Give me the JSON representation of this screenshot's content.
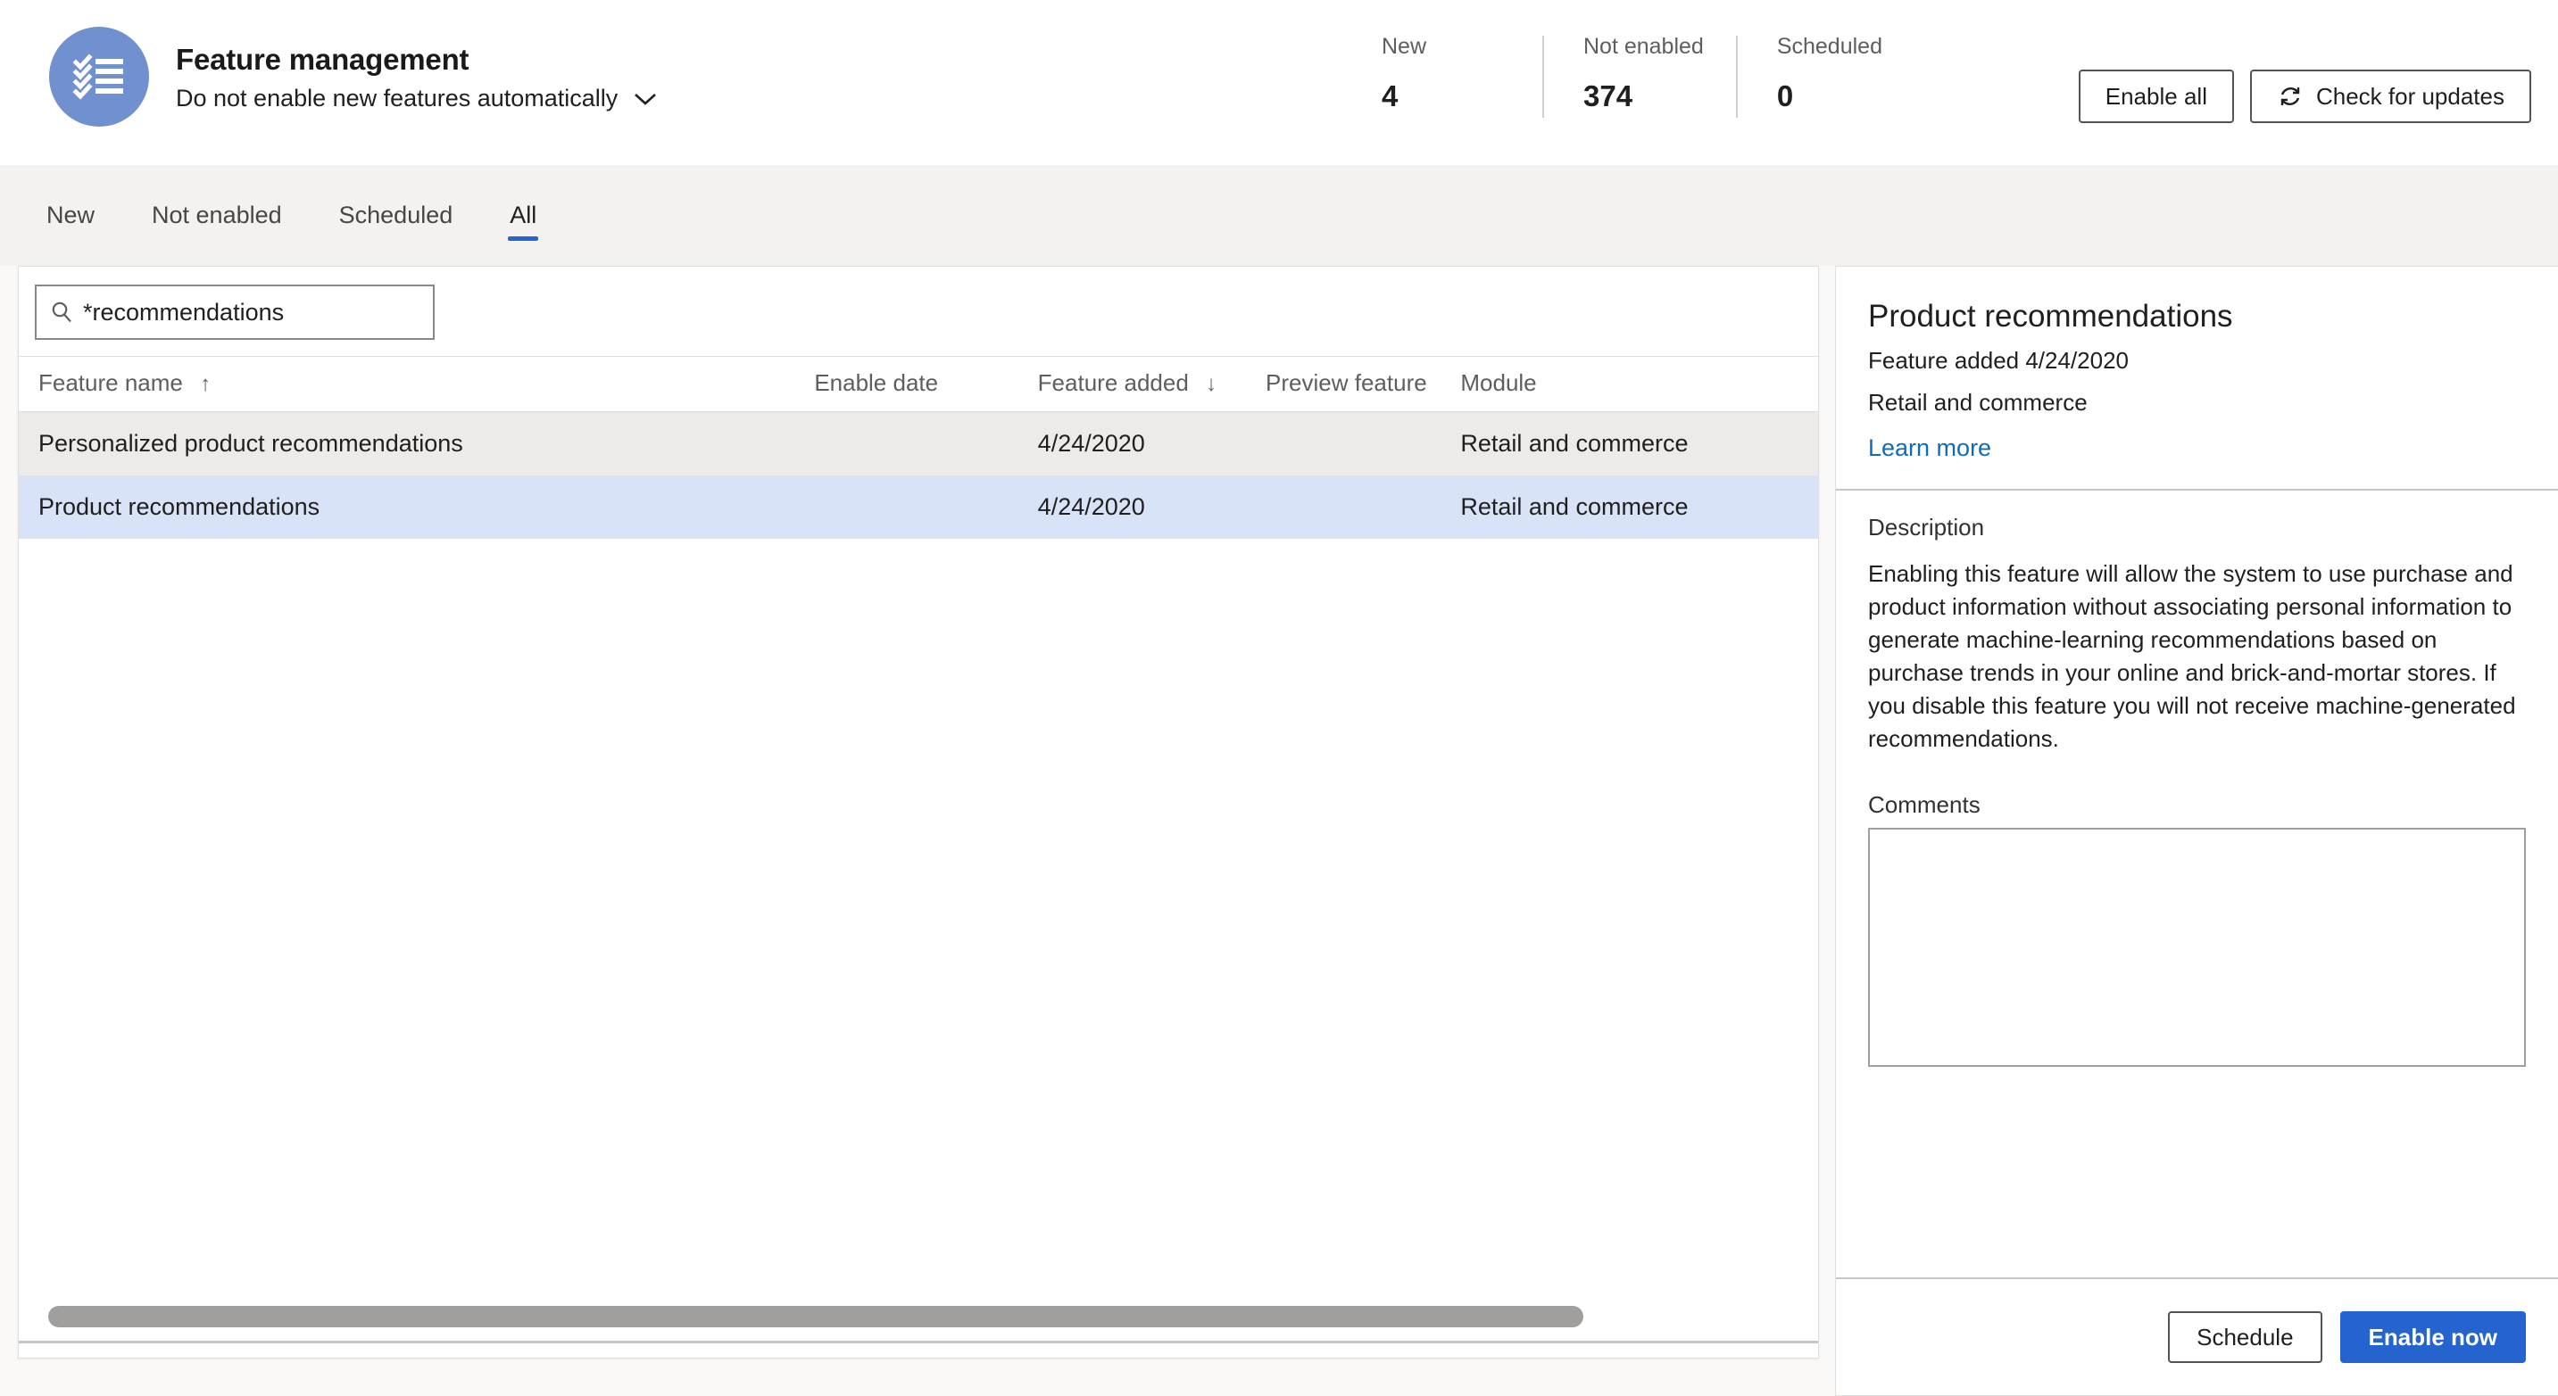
{
  "header": {
    "app_icon_name": "checklist-icon",
    "title": "Feature management",
    "subtitle": "Do not enable new features automatically",
    "subtitle_chevron": "chevron-down-icon",
    "stats": [
      {
        "label": "New",
        "value": "4"
      },
      {
        "label": "Not enabled",
        "value": "374"
      },
      {
        "label": "Scheduled",
        "value": "0"
      }
    ],
    "actions": {
      "enable_all": "Enable all",
      "check_updates": "Check for updates",
      "check_updates_icon": "refresh-icon"
    }
  },
  "tabs": [
    {
      "label": "New",
      "active": false
    },
    {
      "label": "Not enabled",
      "active": false
    },
    {
      "label": "Scheduled",
      "active": false
    },
    {
      "label": "All",
      "active": true
    }
  ],
  "grid": {
    "search": {
      "icon": "search-icon",
      "value": "*recommendations",
      "placeholder": "Filter"
    },
    "columns": [
      {
        "label": "Feature name",
        "sort": "↑"
      },
      {
        "label": "Enable date",
        "sort": ""
      },
      {
        "label": "Feature added",
        "sort": "↓"
      },
      {
        "label": "Preview feature",
        "sort": ""
      },
      {
        "label": "Module",
        "sort": ""
      }
    ],
    "rows": [
      {
        "feature_name": "Personalized product recommendations",
        "enable_date": "",
        "feature_added": "4/24/2020",
        "preview_feature": "",
        "module": "Retail and commerce",
        "state": "hover"
      },
      {
        "feature_name": "Product recommendations",
        "enable_date": "",
        "feature_added": "4/24/2020",
        "preview_feature": "",
        "module": "Retail and commerce",
        "state": "selected"
      }
    ]
  },
  "detail": {
    "title": "Product recommendations",
    "feature_added": "Feature added 4/24/2020",
    "module": "Retail and commerce",
    "learn_more": "Learn more",
    "description_label": "Description",
    "description_text": "Enabling this feature will allow the system to use purchase and product information without associating personal information to generate machine-learning recommendations based on purchase trends in your online and brick-and-mortar stores. If you disable this feature you will not receive machine-generated recommendations.",
    "comments_label": "Comments",
    "comments_value": "",
    "schedule_label": "Schedule",
    "enable_now_label": "Enable now"
  },
  "colors": {
    "accent": "#2564cf",
    "link": "#0f6cbd",
    "icon_bg": "#7190d0",
    "selected_row": "#d8e3f7",
    "hover_row": "#edebe9",
    "tab_bg": "#f3f2f1"
  }
}
